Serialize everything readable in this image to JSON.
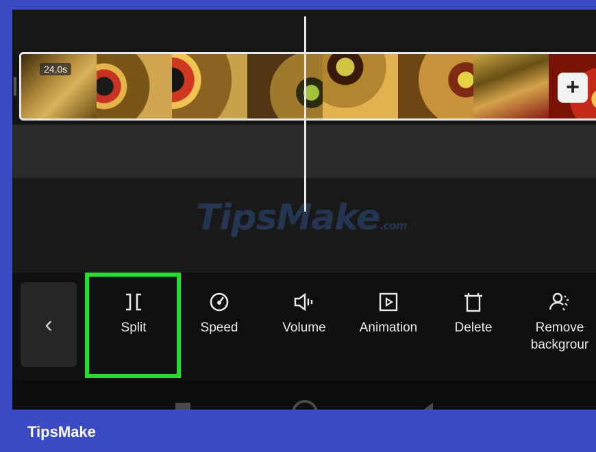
{
  "timeline": {
    "duration_badge": "24.0s",
    "add_button_symbol": "+"
  },
  "watermark": {
    "text": "TipsMake",
    "suffix": ".com"
  },
  "toolbar": {
    "back_symbol": "‹",
    "tools": [
      {
        "id": "split",
        "label": "Split",
        "icon": "split-icon",
        "highlighted": true
      },
      {
        "id": "speed",
        "label": "Speed",
        "icon": "speed-icon"
      },
      {
        "id": "volume",
        "label": "Volume",
        "icon": "volume-icon"
      },
      {
        "id": "animation",
        "label": "Animation",
        "icon": "animation-icon"
      },
      {
        "id": "delete",
        "label": "Delete",
        "icon": "delete-icon"
      },
      {
        "id": "remove_background",
        "label": "Remove\nbackgrour",
        "icon": "remove-background-icon"
      }
    ],
    "highlight_color": "#22e02a"
  },
  "footer": {
    "brand": "TipsMake"
  },
  "colors": {
    "page_background": "#3a4bc4",
    "app_background": "#151515",
    "toolbar_background": "#0f0f0f"
  }
}
